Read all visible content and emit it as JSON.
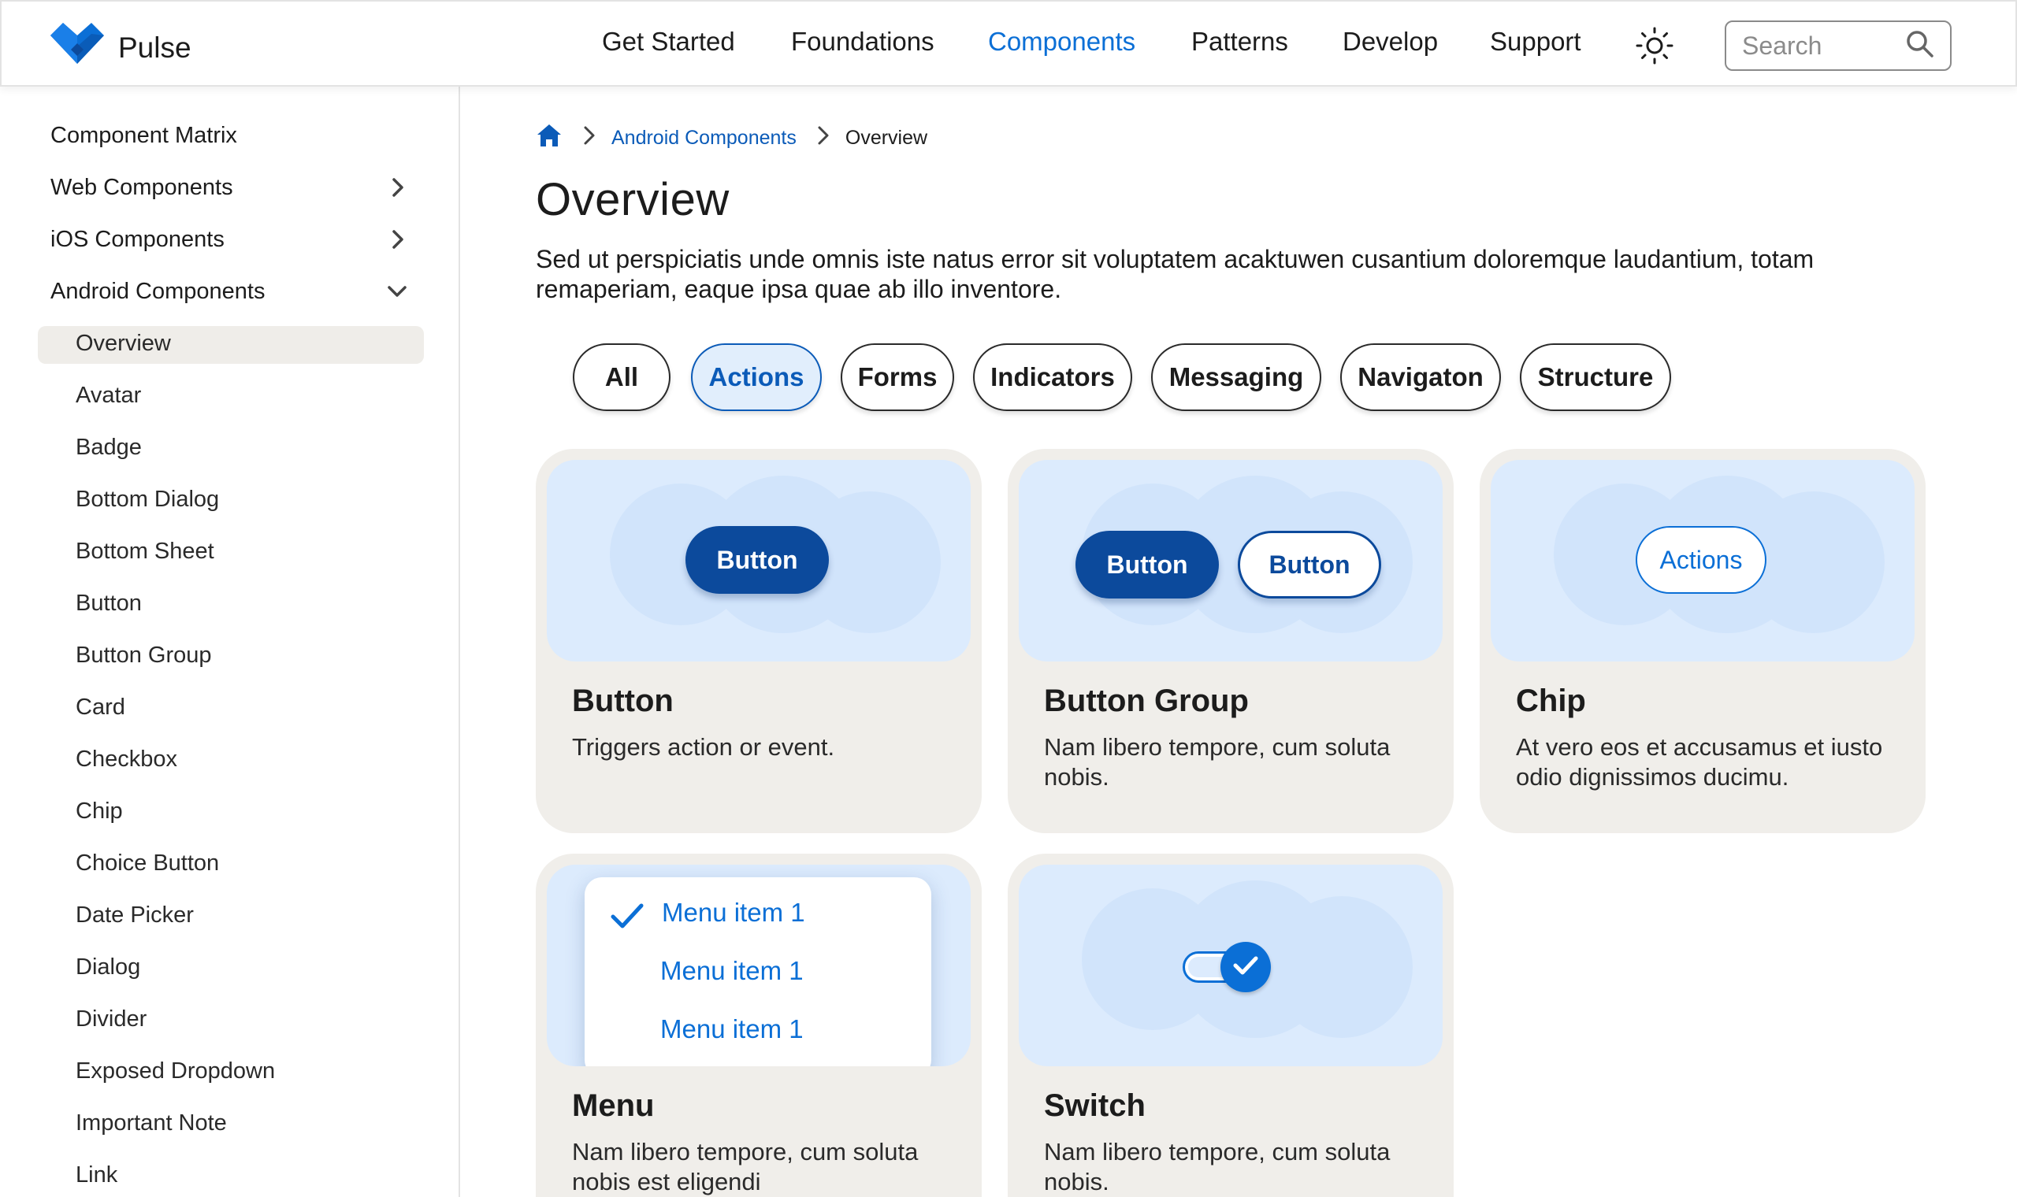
{
  "brand": {
    "name": "Pulse",
    "logo_icon": "heart-logo-icon",
    "logo_color": "#0b6fd6"
  },
  "nav": {
    "items": [
      {
        "label": "Get Started",
        "active": false
      },
      {
        "label": "Foundations",
        "active": false
      },
      {
        "label": "Components",
        "active": true
      },
      {
        "label": "Patterns",
        "active": false
      },
      {
        "label": "Develop",
        "active": false
      },
      {
        "label": "Support",
        "active": false
      }
    ],
    "theme_icon": "sun-icon",
    "search_placeholder": "Search",
    "search_icon": "search-icon"
  },
  "sidebar": {
    "sections": [
      {
        "label": "Component Matrix",
        "chevron": "none"
      },
      {
        "label": "Web Components",
        "chevron": "chevron-right-icon"
      },
      {
        "label": "iOS Components",
        "chevron": "chevron-right-icon"
      },
      {
        "label": "Android Components",
        "chevron": "chevron-down-icon"
      }
    ],
    "sub_items": [
      "Overview",
      "Avatar",
      "Badge",
      "Bottom Dialog",
      "Bottom Sheet",
      "Button",
      "Button Group",
      "Card",
      "Checkbox",
      "Chip",
      "Choice Button",
      "Date Picker",
      "Dialog",
      "Divider",
      "Exposed Dropdown",
      "Important Note",
      "Link"
    ],
    "active_sub_item": "Overview"
  },
  "breadcrumb": {
    "home_icon": "home-icon",
    "link": "Android Components",
    "current": "Overview"
  },
  "page": {
    "title": "Overview",
    "description": "Sed ut perspiciatis unde omnis iste natus error sit voluptatem acaktuwen cusantium doloremque laudantium, totam remaperiam, eaque ipsa quae ab illo inventore."
  },
  "filters": {
    "items": [
      "All",
      "Actions",
      "Forms",
      "Indicators",
      "Messaging",
      "Navigaton",
      "Structure"
    ],
    "active": "Actions"
  },
  "cards": [
    {
      "title": "Button",
      "description": "Triggers action or event.",
      "demo": {
        "button_label": "Button"
      }
    },
    {
      "title": "Button Group",
      "description": "Nam libero tempore, cum soluta nobis.",
      "demo": {
        "primary_label": "Button",
        "secondary_label": "Button"
      }
    },
    {
      "title": "Chip",
      "description": "At vero eos et accusamus et iusto odio dignissimos ducimu.",
      "demo": {
        "chip_label": "Actions"
      }
    },
    {
      "title": "Menu",
      "description": "Nam libero tempore, cum soluta nobis est eligendi",
      "demo": {
        "items": [
          "Menu item 1",
          "Menu item 1",
          "Menu item 1"
        ],
        "checked_index": 0
      }
    },
    {
      "title": "Switch",
      "description": "Nam libero tempore, cum soluta nobis.",
      "demo": {
        "checked": true
      }
    }
  ],
  "colors": {
    "accent": "#0b6fd6",
    "primary_dark": "#0c4a9c",
    "card_bg": "#f0eeea",
    "preview_bg": "#dcebfd"
  }
}
